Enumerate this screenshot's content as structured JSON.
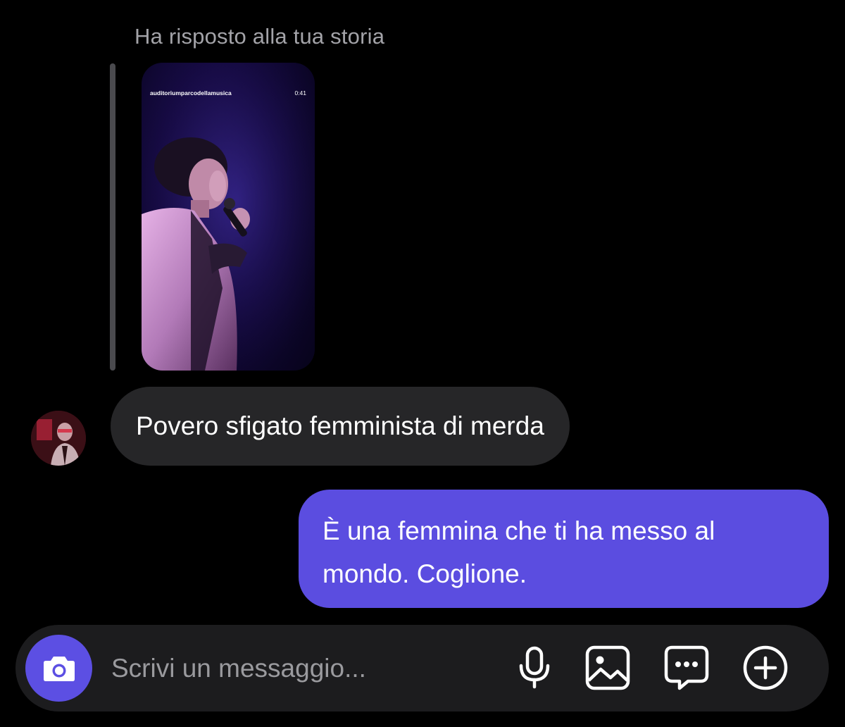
{
  "thread": {
    "reply_context": "Ha risposto alla tua storia",
    "story": {
      "username": "auditoriumparcodellamusica",
      "time": "0:41",
      "image": "singer-with-microphone-photo"
    },
    "incoming_message": {
      "avatar": "contact-avatar",
      "text": "Povero sfigato femminista di merda"
    },
    "outgoing_message": {
      "text": "È una femmina che ti ha messo al mondo. Coglione."
    }
  },
  "composer": {
    "placeholder": "Scrivi un messaggio...",
    "camera_icon": "camera-icon",
    "tools": [
      "microphone-icon",
      "gallery-icon",
      "sticker-message-icon",
      "plus-icon"
    ]
  },
  "colors": {
    "background": "#000000",
    "incoming_bubble": "#262628",
    "outgoing_bubble": "#5b4de0",
    "camera_button": "#5c4fe3",
    "secondary_text": "#a3a3a8",
    "composer_background": "#1c1c1e"
  }
}
